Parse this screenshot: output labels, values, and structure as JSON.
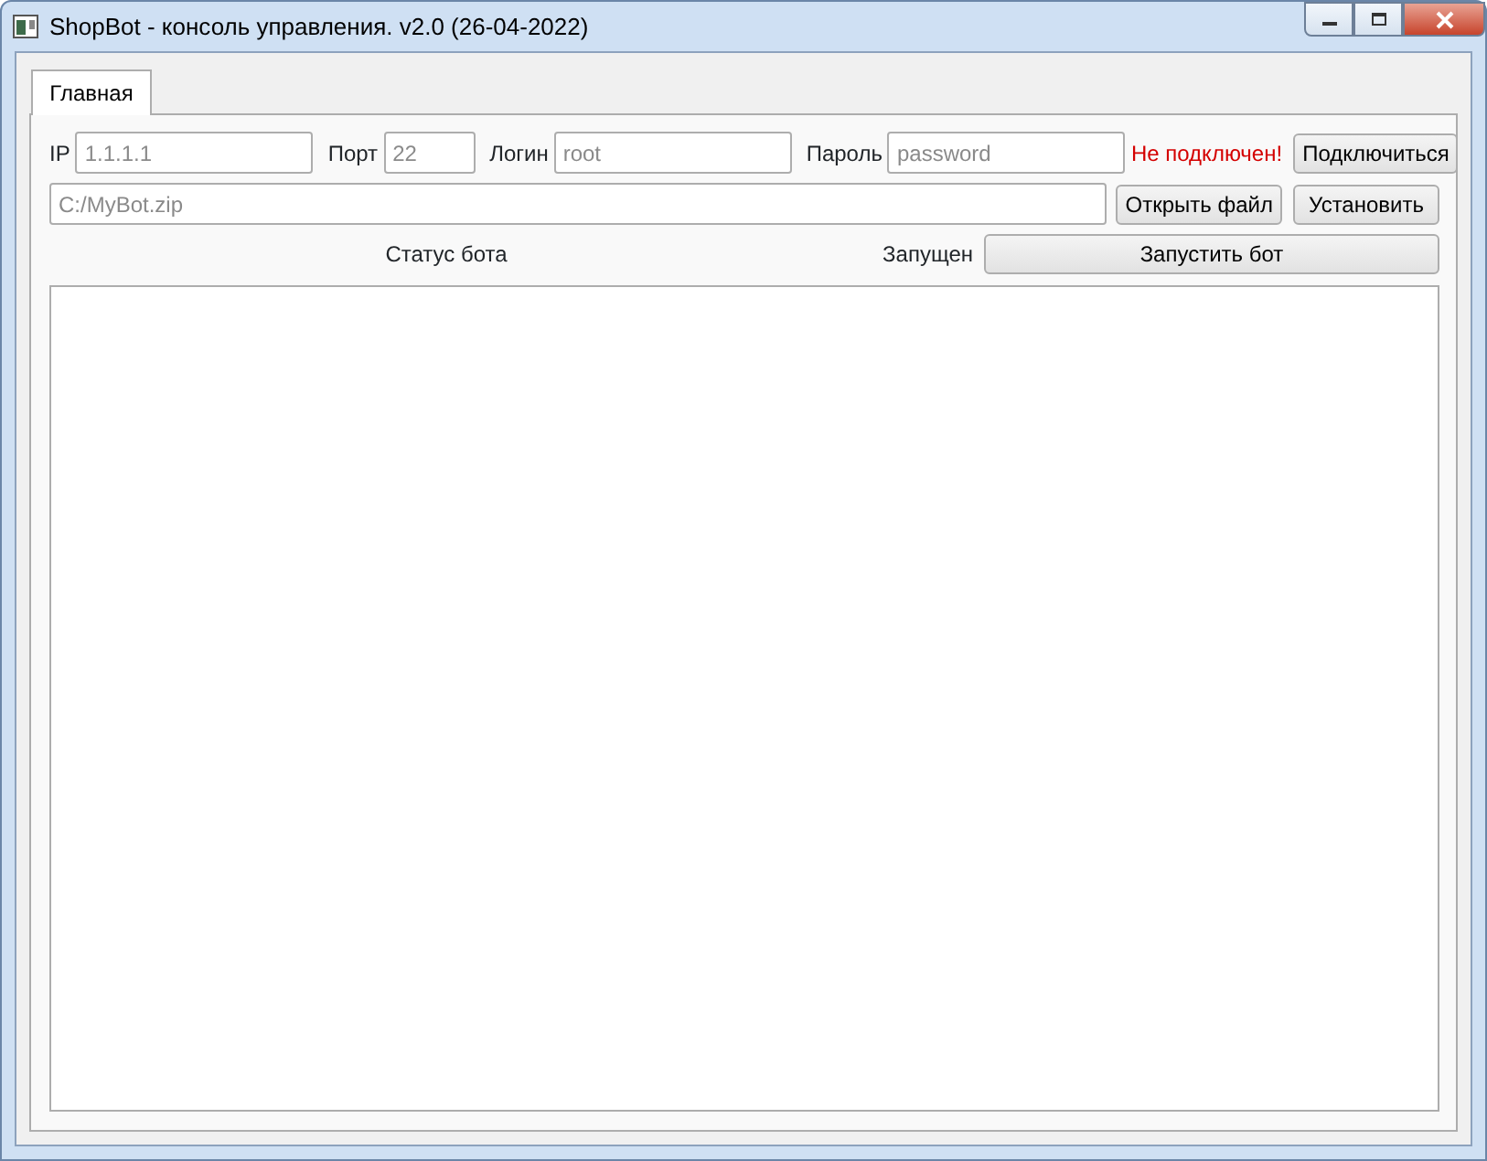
{
  "window": {
    "title": "ShopBot - консоль управления. v2.0 (26-04-2022)"
  },
  "tabs": [
    {
      "label": "Главная",
      "selected": true
    }
  ],
  "connection": {
    "fields": [
      {
        "label": "IP",
        "placeholder": "1.1.1.1"
      },
      {
        "label": "Порт",
        "placeholder": "22"
      },
      {
        "label": "Логин",
        "placeholder": "root"
      },
      {
        "label": "Пароль",
        "placeholder": "password"
      }
    ],
    "status": "Не подключен!",
    "connected": false,
    "button": "Подключиться"
  },
  "file": {
    "placeholder": "C:/MyBot.zip",
    "buttons": [
      "Открыть файл",
      "Установить"
    ]
  },
  "bot": {
    "status_label": "Статус бота",
    "status": "Запущен",
    "button": "Запустить бот"
  }
}
